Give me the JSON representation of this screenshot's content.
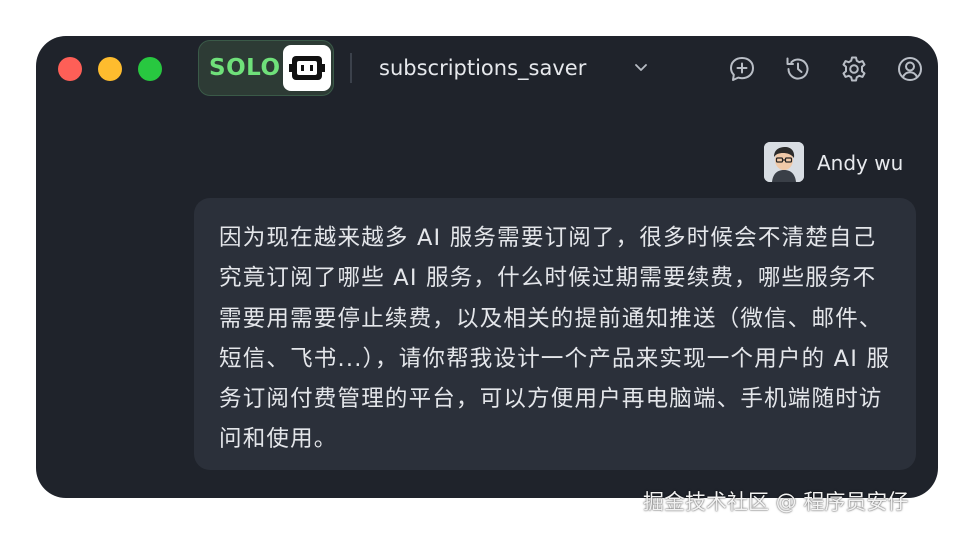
{
  "window": {
    "controls": [
      "close",
      "minimize",
      "maximize"
    ],
    "mode_badge": "SOLO",
    "project_name": "subscriptions_saver",
    "toolbar_icons": [
      "new-chat-icon",
      "history-icon",
      "settings-icon",
      "account-icon"
    ]
  },
  "message": {
    "author": "Andy wu",
    "text": "因为现在越来越多 AI 服务需要订阅了，很多时候会不清楚自己究竟订阅了哪些 AI 服务，什么时候过期需要续费，哪些服务不需要用需要停止续费，以及相关的提前通知推送（微信、邮件、短信、飞书...），请你帮我设计一个产品来实现一个用户的 AI 服务订阅付费管理的平台，可以方便用户再电脑端、手机端随时访问和使用。"
  },
  "watermark": "掘金技术社区 @ 程序员安仔",
  "colors": {
    "window_bg": "#1f232b",
    "bubble_bg": "#2b303a",
    "solo_green": "#6fe07a",
    "close": "#fe5f57",
    "minimize": "#febc2e",
    "maximize": "#28c840"
  }
}
